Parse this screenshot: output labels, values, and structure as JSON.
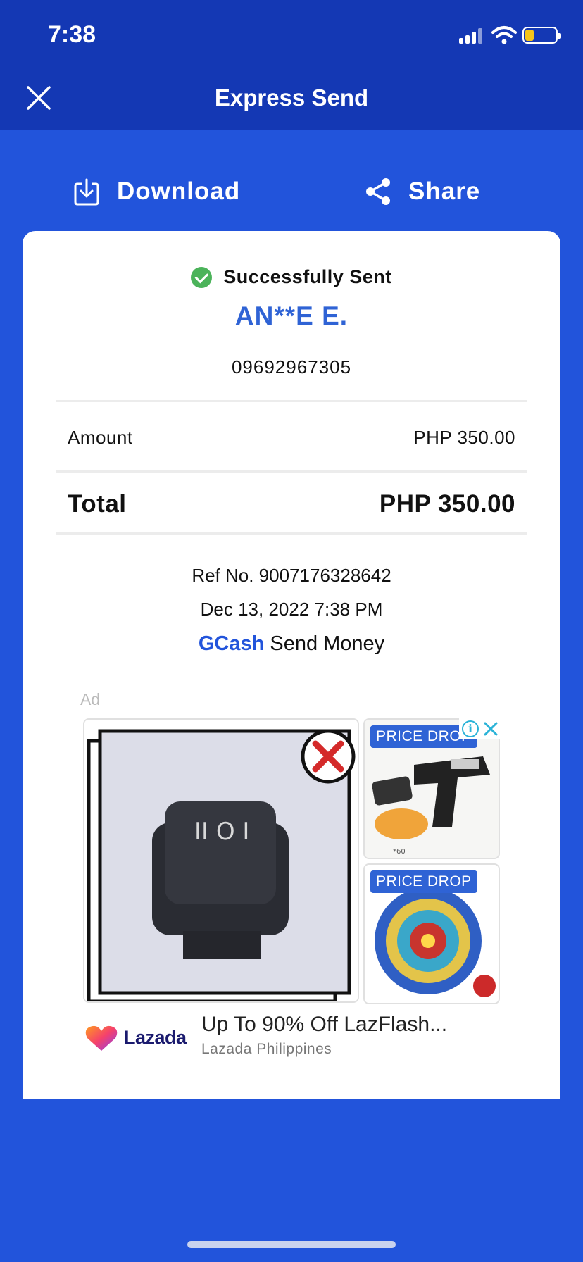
{
  "status_bar": {
    "time": "7:38"
  },
  "nav": {
    "title": "Express Send"
  },
  "actions": {
    "download_label": "Download",
    "share_label": "Share"
  },
  "receipt": {
    "status": "Successfully Sent",
    "recipient_name": "AN**E E.",
    "recipient_number": "09692967305",
    "amount_label": "Amount",
    "amount_value": "PHP 350.00",
    "total_label": "Total",
    "total_value": "PHP 350.00",
    "ref_no": "Ref No. 9007176328642",
    "datetime": "Dec 13, 2022 7:38 PM",
    "service_brand": "GCash",
    "service_name": "Send Money"
  },
  "ad": {
    "label": "Ad",
    "price_tag_1": "PRICE DROP",
    "price_tag_2": "PRICE DROP",
    "image_caption": "*60",
    "advertiser_logo_text": "Lazada",
    "headline": "Up To 90% Off LazFlash...",
    "source": "Lazada Philippines"
  },
  "colors": {
    "nav_bg": "#1438b4",
    "page_bg": "#2254db",
    "accent": "#2f63d5",
    "success": "#4bb35a"
  }
}
